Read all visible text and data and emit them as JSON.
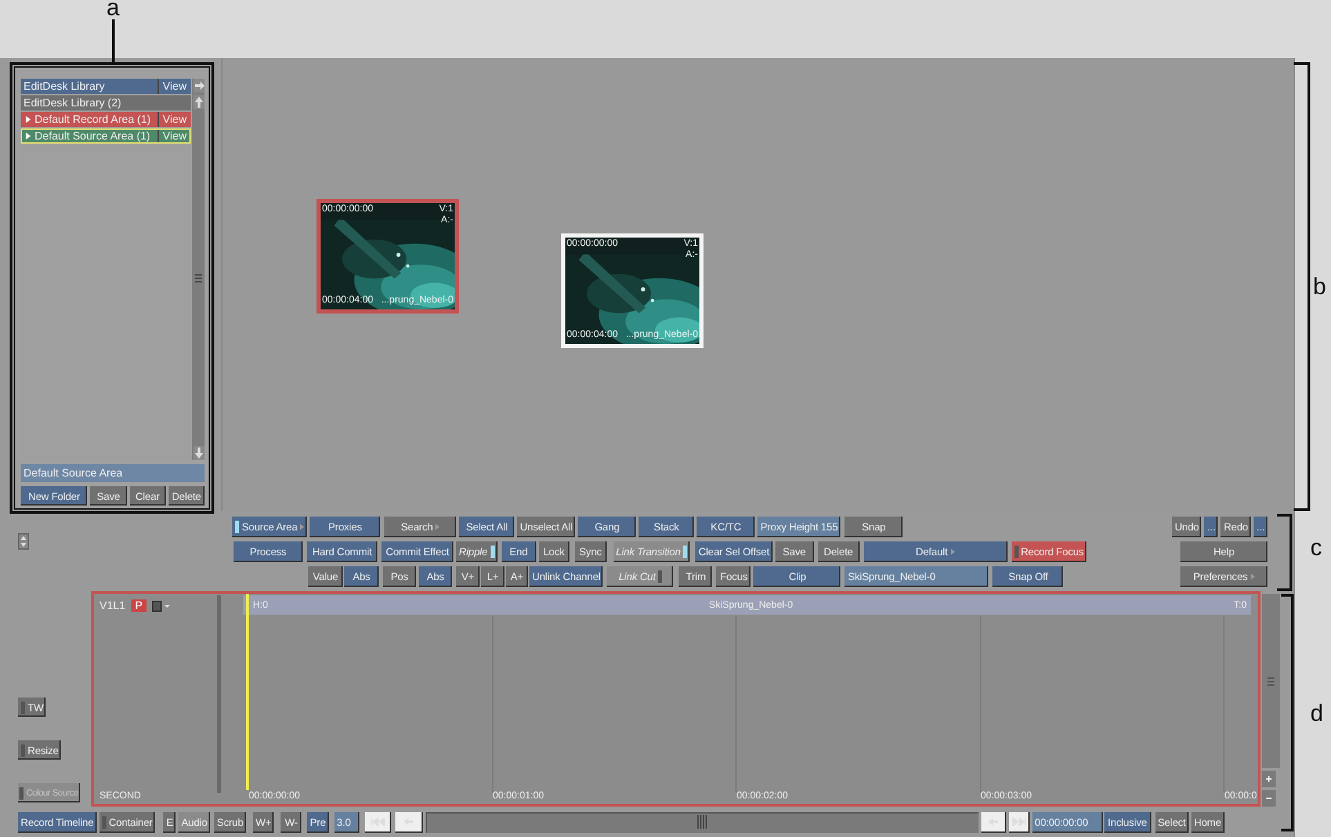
{
  "callouts": [
    {
      "label": "a"
    },
    {
      "label": "b"
    },
    {
      "label": "c"
    },
    {
      "label": "d"
    }
  ],
  "library": {
    "title": "EditDesk Library",
    "title_action": "View",
    "items": [
      {
        "label": "EditDesk Library (2)",
        "kind": "folder",
        "selected": false
      },
      {
        "label": "Default Record Area (1)",
        "kind": "area",
        "color": "#c45353",
        "action": "View",
        "selected": false
      },
      {
        "label": "Default Source Area (1)",
        "kind": "area",
        "color": "#4e8a68",
        "action": "View",
        "selected": true
      }
    ],
    "status": "Default Source Area",
    "buttons": [
      {
        "label": "New Folder",
        "color": "#4f6a8e"
      },
      {
        "label": "Save",
        "color": "#717171"
      },
      {
        "label": "Clear",
        "color": "#717171"
      },
      {
        "label": "Delete",
        "color": "#717171"
      }
    ]
  },
  "viewer": {
    "clips": [
      {
        "color": "#c45353",
        "timecode_in": "00:00:00:00",
        "video": "V:1",
        "audio": "A:-",
        "timecode_out": "00:00:04:00",
        "name": "...prung_Nebel-0"
      },
      {
        "color": "#f4f4f4",
        "timecode_in": "00:00:00:00",
        "video": "V:1",
        "audio": "A:-",
        "timecode_out": "00:00:04:00",
        "name": "...prung_Nebel-0"
      }
    ]
  },
  "toolbar": {
    "rows": [
      {
        "buttons": [
          {
            "label": "Source Area",
            "kind": "toggle",
            "color": "#4f6a8e",
            "on": true,
            "arrow": true
          },
          {
            "label": "Proxies",
            "kind": "button",
            "color": "#4f6a8e"
          },
          {
            "label": "Search",
            "kind": "button",
            "color": "#717171",
            "arrow": true
          },
          {
            "label": "Select All",
            "kind": "button",
            "color": "#4f6a8e"
          },
          {
            "label": "Unselect All",
            "kind": "button",
            "color": "#717171"
          },
          {
            "label": "Gang",
            "kind": "button",
            "color": "#4f6a8e"
          },
          {
            "label": "Stack",
            "kind": "button",
            "color": "#4f6a8e"
          },
          {
            "label": "KC/TC",
            "kind": "button",
            "color": "#4f6a8e"
          },
          {
            "label": "Proxy Height 155",
            "kind": "button",
            "color": "#66819f"
          },
          {
            "label": "Snap",
            "kind": "button",
            "color": "#717171"
          }
        ]
      },
      {
        "buttons": [
          {
            "label": "Process",
            "kind": "button",
            "color": "#4f6a8e"
          },
          {
            "label": "Hard Commit",
            "kind": "button",
            "color": "#4f6a8e"
          },
          {
            "label": "Commit Effect",
            "kind": "button",
            "color": "#4f6a8e"
          },
          {
            "label": "Ripple",
            "kind": "mode",
            "color": "#717171",
            "on": true
          },
          {
            "label": "End",
            "kind": "button",
            "color": "#4f6a8e"
          },
          {
            "label": "Lock",
            "kind": "button",
            "color": "#717171"
          },
          {
            "label": "Sync",
            "kind": "button",
            "color": "#717171"
          },
          {
            "label": "Link Transition",
            "kind": "mode",
            "color": "#8b8b8b",
            "on": true
          },
          {
            "label": "Clear Sel Offset",
            "kind": "button",
            "color": "#4f6a8e"
          },
          {
            "label": "Save",
            "kind": "button",
            "color": "#717171"
          },
          {
            "label": "Delete",
            "kind": "button",
            "color": "#717171"
          },
          {
            "label": "Default",
            "kind": "button",
            "color": "#4f6a8e",
            "arrow": true
          },
          {
            "label": "Record Focus",
            "kind": "toggle",
            "color": "#c45353",
            "on": false
          }
        ]
      },
      {
        "buttons": [
          {
            "label": "Value",
            "kind": "button",
            "color": "#717171"
          },
          {
            "label": "Abs",
            "kind": "button",
            "color": "#4f6a8e"
          },
          {
            "label": "Pos",
            "kind": "button",
            "color": "#717171"
          },
          {
            "label": "Abs",
            "kind": "button",
            "color": "#4f6a8e"
          },
          {
            "label": "V+",
            "kind": "button",
            "color": "#717171"
          },
          {
            "label": "L+",
            "kind": "button",
            "color": "#717171"
          },
          {
            "label": "A+",
            "kind": "button",
            "color": "#717171"
          },
          {
            "label": "Unlink Channel",
            "kind": "button",
            "color": "#4f6a8e"
          },
          {
            "label": "Link Cut",
            "kind": "mode",
            "color": "#8b8b8b",
            "on": false
          },
          {
            "label": "Trim",
            "kind": "button",
            "color": "#717171"
          },
          {
            "label": "Focus",
            "kind": "button",
            "color": "#717171"
          },
          {
            "label": "Clip",
            "kind": "button",
            "color": "#4f6a8e"
          },
          {
            "label": "SkiSprung_Nebel-0",
            "kind": "field",
            "color": "#66819f"
          },
          {
            "label": "Snap Off",
            "kind": "button",
            "color": "#4f6a8e"
          }
        ]
      }
    ],
    "side": [
      {
        "buttons": [
          {
            "label": "Undo",
            "color": "#717171"
          },
          {
            "label": "...",
            "color": "#4f6a8e"
          },
          {
            "label": "Redo",
            "color": "#717171"
          },
          {
            "label": "...",
            "color": "#4f6a8e"
          }
        ]
      },
      {
        "buttons": [
          {
            "label": "Help",
            "color": "#717171"
          }
        ]
      },
      {
        "buttons": [
          {
            "label": "Preferences",
            "color": "#717171",
            "arrow": true
          }
        ]
      }
    ]
  },
  "tools": [
    {
      "label": "TW",
      "disabled": false
    },
    {
      "label": "Resize",
      "disabled": false
    },
    {
      "label": "Colour Source",
      "disabled": true
    }
  ],
  "timeline": {
    "track": "V1L1",
    "badge": "P",
    "clip": {
      "name": "SkiSprung_Nebel-0",
      "head": "H:0",
      "tail": "T:0"
    },
    "unit": "SECOND",
    "ticks": [
      "00:00:00:00",
      "00:00:01:00",
      "00:00:02:00",
      "00:00:03:00",
      "00:00:0"
    ]
  },
  "bottom_bar": [
    {
      "label": "Record Timeline",
      "kind": "button",
      "color": "#4f6a8e"
    },
    {
      "label": "Container",
      "kind": "toggle",
      "color": "#717171",
      "on": false
    },
    {
      "label": "E",
      "kind": "button",
      "color": "#717171"
    },
    {
      "label": "Audio",
      "kind": "button",
      "color": "#8b8b8b"
    },
    {
      "label": "Scrub",
      "kind": "button",
      "color": "#717171"
    },
    {
      "label": "W+",
      "kind": "button",
      "color": "#717171"
    },
    {
      "label": "W-",
      "kind": "button",
      "color": "#717171"
    },
    {
      "label": "Pre",
      "kind": "button",
      "color": "#4f6a8e"
    },
    {
      "label": "3.0",
      "kind": "field",
      "color": "#66819f"
    },
    {
      "kind": "skip-start"
    },
    {
      "kind": "step-back"
    },
    {
      "kind": "scrubber"
    },
    {
      "kind": "step-back"
    },
    {
      "kind": "skip-end"
    },
    {
      "label": "00:00:00:00",
      "kind": "field",
      "color": "#66819f"
    },
    {
      "label": "Inclusive",
      "kind": "button",
      "color": "#4f6a8e"
    },
    {
      "label": "Select",
      "kind": "button",
      "color": "#717171"
    },
    {
      "label": "Home",
      "kind": "button",
      "color": "#717171"
    }
  ]
}
